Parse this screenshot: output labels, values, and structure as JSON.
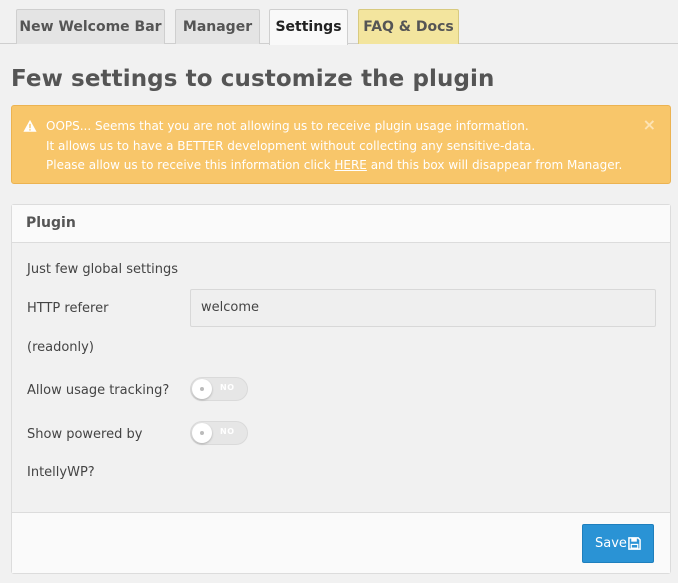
{
  "tabs": [
    {
      "label": "New Welcome Bar"
    },
    {
      "label": "Manager"
    },
    {
      "label": "Settings"
    },
    {
      "label": "FAQ & Docs"
    }
  ],
  "page": {
    "title": "Few settings to customize the plugin"
  },
  "alert": {
    "line1": "OOPS... Seems that you are not allowing us to receive plugin usage information.",
    "line2": "It allows us to have a BETTER development without collecting any sensitive-data.",
    "line3_before": "Please allow us to receive this information click ",
    "line3_link": "HERE",
    "line3_after": " and this box will disappear from Manager.",
    "close": "×",
    "icon": "warning-icon"
  },
  "panel": {
    "title": "Plugin",
    "intro": "Just few global settings",
    "http_referer": {
      "label": "HTTP referer",
      "sublabel": "(readonly)",
      "value": "welcome"
    },
    "usage_tracking": {
      "label": "Allow usage tracking?",
      "state": "NO"
    },
    "powered_by": {
      "label": "Show powered by",
      "label2": "IntellyWP?",
      "state": "NO"
    },
    "save_label": "Save"
  },
  "colors": {
    "alert_bg": "#f8c66a",
    "save_bg": "#2a93d5",
    "faq_tab_bg": "#f3e59e"
  }
}
